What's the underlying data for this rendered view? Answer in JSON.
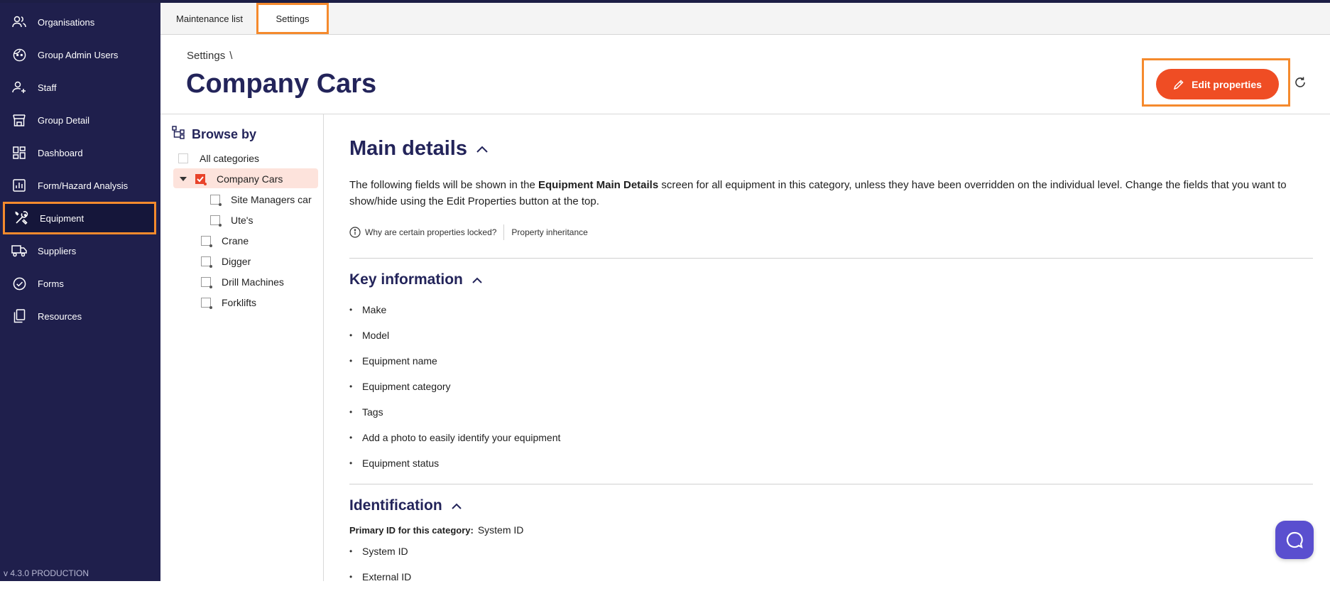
{
  "sidebar": {
    "items": [
      {
        "label": "Organisations",
        "icon": "users-icon"
      },
      {
        "label": "Group Admin Users",
        "icon": "face-icon"
      },
      {
        "label": "Staff",
        "icon": "staff-icon"
      },
      {
        "label": "Group Detail",
        "icon": "store-icon"
      },
      {
        "label": "Dashboard",
        "icon": "dashboard-icon"
      },
      {
        "label": "Form/Hazard Analysis",
        "icon": "chart-icon"
      },
      {
        "label": "Equipment",
        "icon": "tools-icon"
      },
      {
        "label": "Suppliers",
        "icon": "truck-icon"
      },
      {
        "label": "Forms",
        "icon": "check-circle-icon"
      },
      {
        "label": "Resources",
        "icon": "copy-icon"
      }
    ],
    "active": "Equipment",
    "version": "v 4.3.0 PRODUCTION"
  },
  "tabs": [
    {
      "label": "Maintenance list"
    },
    {
      "label": "Settings"
    }
  ],
  "header": {
    "breadcrumb": "Settings",
    "breadcrumb_sep": "\\",
    "title": "Company Cars",
    "edit_label": "Edit properties"
  },
  "browse": {
    "title": "Browse by",
    "items": [
      {
        "label": "All categories"
      },
      {
        "label": "Company Cars"
      },
      {
        "label": "Site Managers car"
      },
      {
        "label": "Ute's"
      },
      {
        "label": "Crane"
      },
      {
        "label": "Digger"
      },
      {
        "label": "Drill Machines"
      },
      {
        "label": "Forklifts"
      }
    ]
  },
  "main": {
    "main_details_title": "Main details",
    "desc_part1": "The following fields will be shown in the ",
    "desc_bold": "Equipment Main Details",
    "desc_part2": " screen for all equipment in this category, unless they have been overridden on the individual level. Change the fields that you want to show/hide using the Edit Properties button at the top.",
    "locked_link": "Why are certain properties locked?",
    "inheritance_link": "Property inheritance",
    "key_info_title": "Key information",
    "key_info_items": [
      "Make",
      "Model",
      "Equipment name",
      "Equipment category",
      "Tags",
      "Add a photo to easily identify your equipment",
      "Equipment status"
    ],
    "identification_title": "Identification",
    "primary_id_label": "Primary ID for this category:",
    "primary_id_value": "System ID",
    "identification_items": [
      "System ID",
      "External ID"
    ]
  },
  "colors": {
    "sidebar_bg": "#1f1f4c",
    "accent": "#ef4d24",
    "highlight": "#f58a2d",
    "title": "#23245a"
  }
}
